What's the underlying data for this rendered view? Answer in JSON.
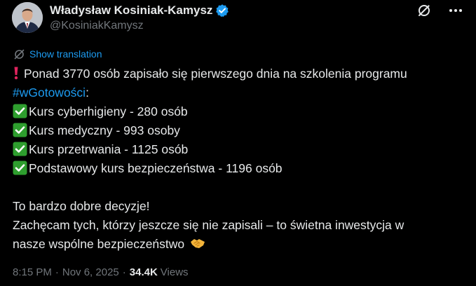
{
  "author": {
    "display_name": "Władysław Kosiniak-Kamysz",
    "handle": "@KosiniakKamysz",
    "verified": true
  },
  "icons": {
    "verified": "verified-badge-icon",
    "grok": "grok-icon",
    "more": "more-icon",
    "translate": "translate-icon",
    "exclamation": "red-exclamation-icon",
    "check": "green-check-icon",
    "handshake": "handshake-icon"
  },
  "colors": {
    "background": "#000000",
    "text": "#e7e9ea",
    "muted": "#71767b",
    "link": "#1d9bf0",
    "check": "#2e9e2e",
    "exclamation": "#e0245e",
    "handshake": "#f3b43a"
  },
  "translate": {
    "label": "Show translation"
  },
  "tweet": {
    "line1": "Ponad 3770 osób zapisało się pierwszego dnia na szkolenia programu",
    "hashtag": "#wGotowości",
    "colon": ":",
    "items": [
      "Kurs cyberhigieny - 280 osób",
      "Kurs medyczny - 993 osoby",
      "Kurs przetrwania - 1125 osób",
      "Podstawowy kurs bezpieczeństwa - 1196 osób"
    ],
    "closing1": "To bardzo dobre decyzje!",
    "closing2": "Zachęcam tych, którzy jeszcze się nie zapisali – to świetna inwestycja w",
    "closing3": "nasze wspólne bezpieczeństwo"
  },
  "meta": {
    "time": "8:15 PM",
    "separator1": "·",
    "date": "Nov 6, 2025",
    "separator2": "·",
    "views_count": "34.4K",
    "views_label": "Views"
  }
}
